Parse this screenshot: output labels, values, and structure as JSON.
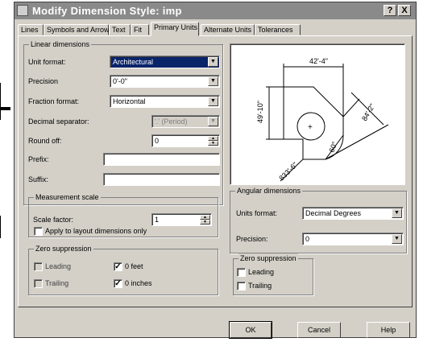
{
  "window": {
    "title": "Modify Dimension Style: imp",
    "help_glyph": "?",
    "close_glyph": "X"
  },
  "tabs": [
    "Lines",
    "Symbols and Arrows",
    "Text",
    "Fit",
    "Primary Units",
    "Alternate Units",
    "Tolerances"
  ],
  "active_tab": "Primary Units",
  "linear": {
    "group_label": "Linear dimensions",
    "unit_format_label": "Unit format:",
    "unit_format_value": "Architectural",
    "precision_label": "Precision",
    "precision_value": "0'-0\"",
    "fraction_format_label": "Fraction format:",
    "fraction_format_value": "Horizontal",
    "decimal_separator_label": "Decimal separator:",
    "decimal_separator_value": "'.' (Period)",
    "round_off_label": "Round off:",
    "round_off_value": "0",
    "prefix_label": "Prefix:",
    "prefix_value": "",
    "suffix_label": "Suffix:",
    "suffix_value": ""
  },
  "measurement": {
    "group_label": "Measurement scale",
    "scale_factor_label": "Scale factor:",
    "scale_factor_value": "1",
    "apply_layout_label": "Apply to layout dimensions only",
    "apply_layout_checked": false
  },
  "zero_linear": {
    "group_label": "Zero suppression",
    "leading_label": "Leading",
    "trailing_label": "Trailing",
    "feet_label": "0 feet",
    "inches_label": "0 inches",
    "feet_checked": true,
    "inches_checked": true,
    "check_glyph": "✓"
  },
  "preview": {
    "dim_top": "42'-4\"",
    "dim_left": "49'-10\"",
    "dim_right": "84'-2\"",
    "dim_angle": "60°",
    "dim_bottom": "833'-6\""
  },
  "angular": {
    "group_label": "Angular dimensions",
    "units_format_label": "Units format:",
    "units_format_value": "Decimal Degrees",
    "precision_label": "Precision:",
    "precision_value": "0"
  },
  "zero_angular": {
    "group_label": "Zero suppression",
    "leading_label": "Leading",
    "trailing_label": "Trailing"
  },
  "buttons": {
    "ok": "OK",
    "cancel": "Cancel",
    "help": "Help"
  },
  "glyphs": {
    "dropdown": "▼",
    "spin_up": "▲",
    "spin_down": "▼",
    "plus": "+"
  }
}
